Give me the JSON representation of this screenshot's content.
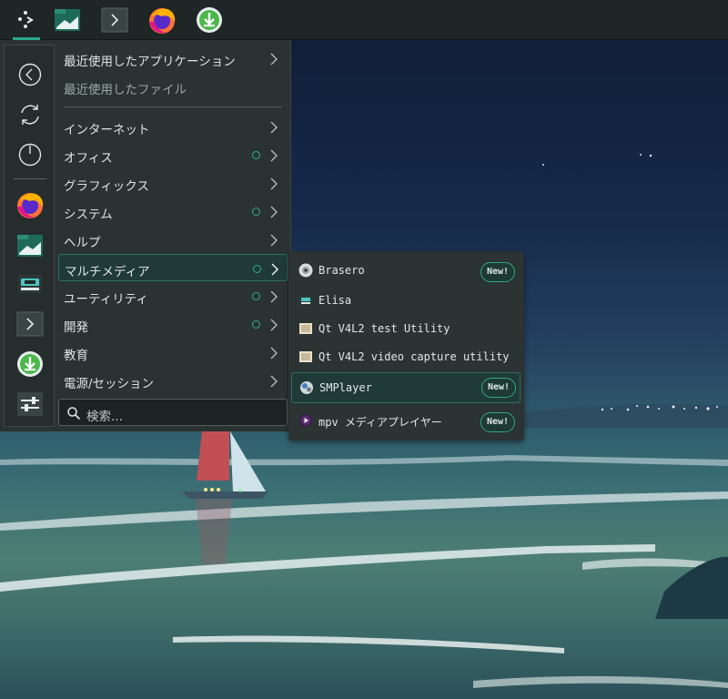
{
  "panel": {
    "buttons": [
      {
        "icon": "app-launcher-icon"
      },
      {
        "icon": "file-manager-icon"
      },
      {
        "icon": "terminal-icon"
      },
      {
        "icon": "firefox-icon"
      },
      {
        "icon": "download-manager-icon"
      }
    ]
  },
  "sidebar": {
    "items": [
      {
        "icon": "back-icon"
      },
      {
        "icon": "refresh-icon"
      },
      {
        "icon": "power-icon"
      },
      {
        "icon": "firefox-icon"
      },
      {
        "icon": "file-manager-icon"
      },
      {
        "icon": "media-player-icon"
      },
      {
        "icon": "terminal-icon"
      },
      {
        "icon": "download-manager-icon"
      },
      {
        "icon": "settings-icon"
      }
    ]
  },
  "menu": {
    "recent_apps": "最近使用したアプリケーション",
    "recent_files": "最近使用したファイル",
    "categories": [
      {
        "label": "インターネット",
        "new_dot": false
      },
      {
        "label": "オフィス",
        "new_dot": true
      },
      {
        "label": "グラフィックス",
        "new_dot": false
      },
      {
        "label": "システム",
        "new_dot": true
      },
      {
        "label": "ヘルプ",
        "new_dot": false
      },
      {
        "label": "マルチメディア",
        "new_dot": true
      },
      {
        "label": "ユーティリティ",
        "new_dot": true
      },
      {
        "label": "開発",
        "new_dot": true
      },
      {
        "label": "教育",
        "new_dot": false
      },
      {
        "label": "電源/セッション",
        "new_dot": false
      }
    ],
    "search_placeholder": "検索..."
  },
  "submenu": {
    "apps": [
      {
        "name": "Brasero",
        "badge": "New!",
        "icon": "brasero-icon"
      },
      {
        "name": "Elisa",
        "badge": "",
        "icon": "elisa-icon"
      },
      {
        "name": "Qt V4L2 test Utility",
        "badge": "",
        "icon": "qt-v4l2-icon"
      },
      {
        "name": "Qt V4L2 video capture utility",
        "badge": "",
        "icon": "qt-v4l2-capture-icon"
      },
      {
        "name": "SMPlayer",
        "badge": "New!",
        "icon": "smplayer-icon"
      },
      {
        "name": "mpv メディアプレイヤー",
        "badge": "New!",
        "icon": "mpv-icon"
      }
    ]
  },
  "colors": {
    "accent": "#2aa88a",
    "panel_bg": "#1f2626",
    "menu_bg": "#2a3232",
    "badge_border": "#34a77d"
  }
}
